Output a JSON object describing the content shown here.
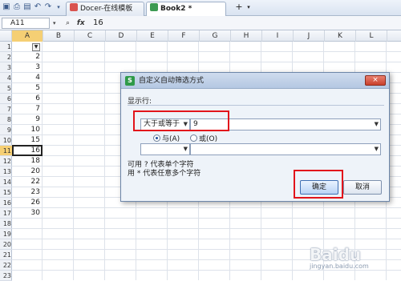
{
  "tabs": [
    {
      "label": "Docer-在线模板",
      "icon_color": "#d9534f"
    },
    {
      "label": "Book2 *",
      "icon_color": "#3c9a52"
    }
  ],
  "formula_bar": {
    "cell_ref": "A11",
    "fx_label": "fx",
    "value": "16"
  },
  "columns": [
    "A",
    "B",
    "C",
    "D",
    "E",
    "F",
    "G",
    "H",
    "I",
    "J",
    "K",
    "L"
  ],
  "rows": [
    "1",
    "2",
    "3",
    "4",
    "5",
    "6",
    "7",
    "8",
    "9",
    "10",
    "11",
    "12",
    "13",
    "14",
    "15",
    "16",
    "17",
    "18",
    "19",
    "20",
    "21",
    "22",
    "23"
  ],
  "cells_a": [
    "",
    "2",
    "3",
    "4",
    "5",
    "6",
    "7",
    "9",
    "10",
    "15",
    "16",
    "18",
    "20",
    "22",
    "23",
    "26",
    "30"
  ],
  "dialog": {
    "title": "自定义自动筛选方式",
    "close_label": "×",
    "show_rows_label": "显示行:",
    "criteria1_operator": "大于或等于",
    "criteria1_value": "9",
    "and_label": "与(A)",
    "or_label": "或(O)",
    "selected_logic": "and",
    "criteria2_operator": "",
    "criteria2_value": "",
    "hint1": "可用 ? 代表单个字符",
    "hint2": "用 * 代表任意多个字符",
    "ok_label": "确定",
    "cancel_label": "取消"
  },
  "watermark": {
    "text": "Baidu",
    "sub": "jingyan.baidu.com"
  },
  "colors": {
    "highlight": "#e2141b",
    "selected_header": "#f5cf74",
    "spreadsheet_icon": "#2f9a49"
  }
}
